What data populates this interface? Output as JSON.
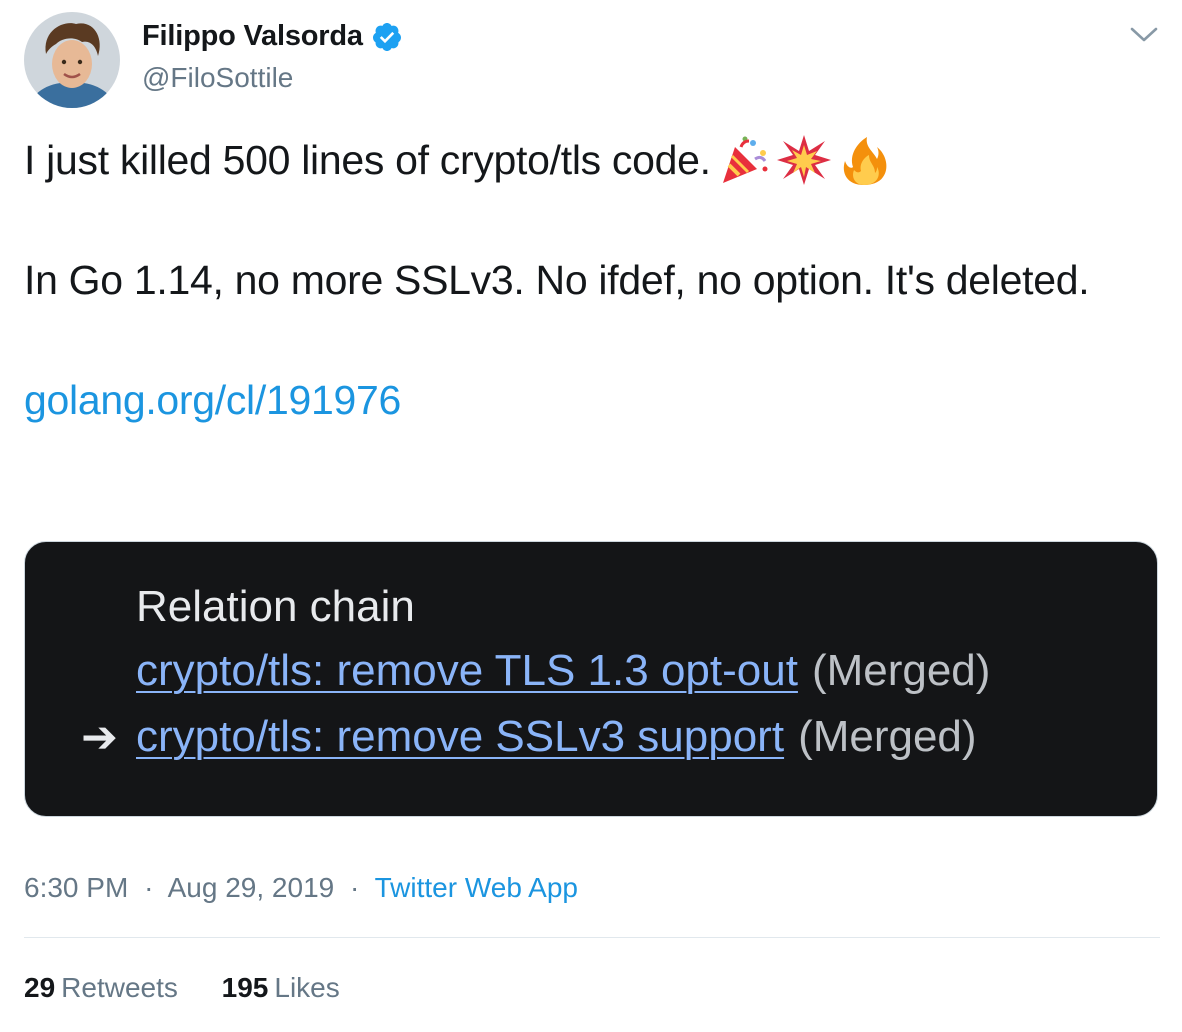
{
  "author": {
    "display_name": "Filippo Valsorda",
    "handle": "@FiloSottile",
    "verified": true
  },
  "tweet": {
    "line1": "I just killed 500 lines of crypto/tls code.",
    "emojis": [
      "party-popper-icon",
      "collision-icon",
      "fire-icon"
    ],
    "line2": "In Go 1.14, no more SSLv3. No ifdef, no option. It's deleted.",
    "link_text": "golang.org/cl/191976"
  },
  "media": {
    "title": "Relation chain",
    "items": [
      {
        "label": "crypto/tls: remove TLS 1.3 opt-out",
        "status": "(Merged)",
        "current": false
      },
      {
        "label": "crypto/tls: remove SSLv3 support",
        "status": "(Merged)",
        "current": true
      }
    ],
    "arrow": "➔",
    "background": "#141517",
    "link_color": "#8ab4f8"
  },
  "meta": {
    "time": "6:30 PM",
    "separator": "·",
    "date": "Aug 29, 2019",
    "source": "Twitter Web App"
  },
  "stats": {
    "retweets_count": "29",
    "retweets_label": "Retweets",
    "likes_count": "195",
    "likes_label": "Likes"
  },
  "colors": {
    "accent": "#1b95e0",
    "secondary_text": "#657786",
    "primary_text": "#14171a",
    "verified": "#1da1f2"
  }
}
